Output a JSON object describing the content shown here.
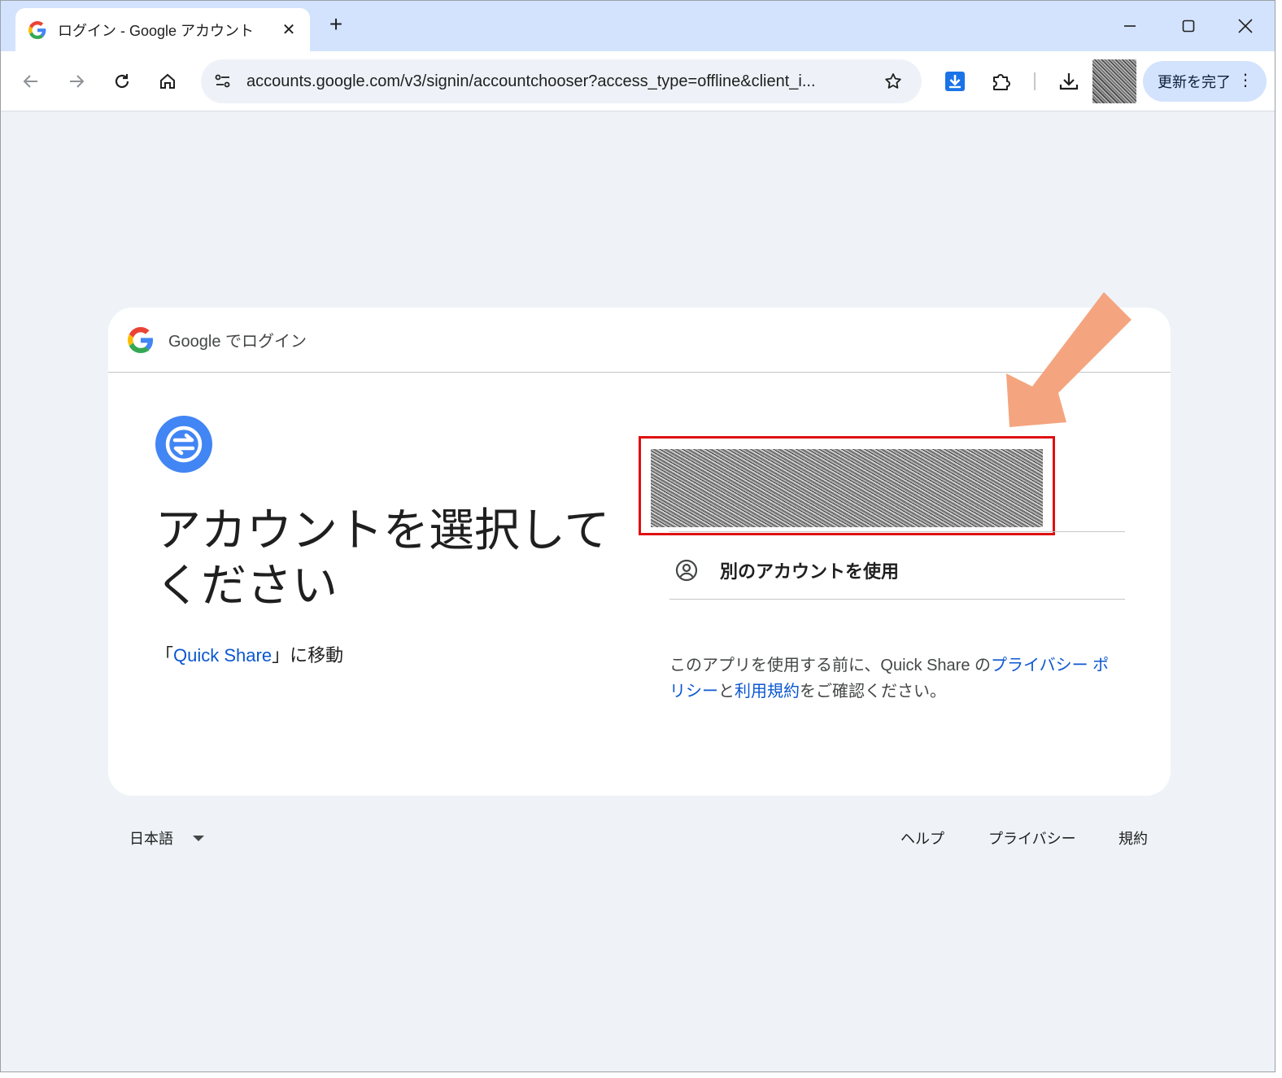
{
  "browser": {
    "tab_title": "ログイン - Google アカウント",
    "tab_close": "✕",
    "new_tab": "+",
    "url": "accounts.google.com/v3/signin/accountchooser?access_type=offline&client_i...",
    "update_button": "更新を完了",
    "update_menu": "⋮"
  },
  "page": {
    "header_text": "Google でログイン",
    "title": "アカウントを選択してください",
    "continue_prefix": "「",
    "continue_app": "Quick Share",
    "continue_suffix": "」に移動",
    "use_other_account": "別のアカウントを使用",
    "notice_prefix": "このアプリを使用する前に、Quick Share の",
    "notice_privacy": "プライバシー ポリシー",
    "notice_and": "と",
    "notice_terms": "利用規約",
    "notice_suffix": "をご確認ください。"
  },
  "footer": {
    "language": "日本語",
    "help": "ヘルプ",
    "privacy": "プライバシー",
    "terms": "規約"
  },
  "colors": {
    "accent": "#0b57d0",
    "app_icon": "#4285f4",
    "highlight_box": "#e01010",
    "annotation_arrow": "#f4a57f"
  }
}
